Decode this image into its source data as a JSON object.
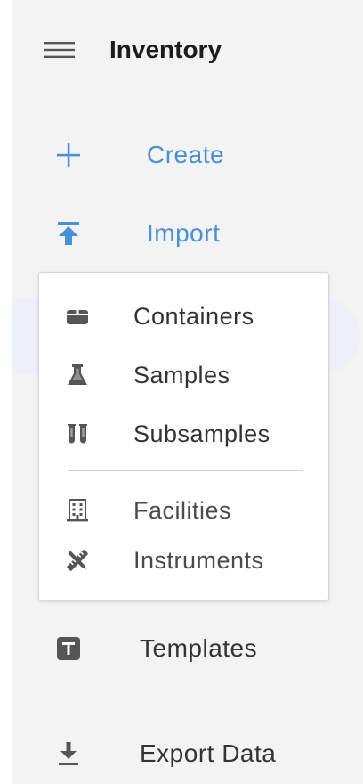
{
  "header": {
    "menu_icon": "hamburger-icon",
    "title": "Inventory"
  },
  "nav": {
    "create": {
      "label": "Create",
      "icon": "plus-icon"
    },
    "import": {
      "label": "Import",
      "icon": "upload-icon"
    },
    "templates": {
      "label": "Templates",
      "icon": "template-t-icon"
    },
    "export": {
      "label": "Export Data",
      "icon": "download-icon"
    }
  },
  "create_menu": {
    "items": [
      {
        "label": "Containers",
        "icon": "box-icon"
      },
      {
        "label": "Samples",
        "icon": "flask-icon"
      },
      {
        "label": "Subsamples",
        "icon": "test-tubes-icon"
      },
      {
        "label": "Facilities",
        "icon": "building-icon"
      },
      {
        "label": "Instruments",
        "icon": "tools-icon"
      }
    ]
  },
  "colors": {
    "accent": "#4a90d9",
    "text": "#333333",
    "drawer_bg": "#f3f3f3"
  }
}
